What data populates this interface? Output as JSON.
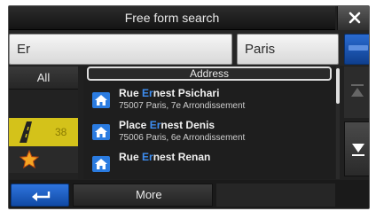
{
  "title": "Free form search",
  "search": {
    "query": "Er",
    "city": "Paris"
  },
  "tabs": {
    "all_label": "All",
    "road_count": "38"
  },
  "list": {
    "header": "Address",
    "items": [
      {
        "name_pre": "Rue ",
        "name_hl": "Er",
        "name_post": "nest Psichari",
        "address": "75007 Paris, 7e Arrondissement"
      },
      {
        "name_pre": "Place ",
        "name_hl": "Er",
        "name_post": "nest Denis",
        "address": "75006 Paris, 6e Arrondissement"
      },
      {
        "name_pre": "Rue ",
        "name_hl": "Er",
        "name_post": "nest Renan",
        "address": ""
      }
    ]
  },
  "bottom": {
    "more_label": "More"
  },
  "icons": {
    "close": "close-icon",
    "home": "house-icon",
    "road": "road-icon",
    "favorite": "star-icon",
    "up": "arrow-up-icon",
    "down": "arrow-down-icon",
    "back": "back-arrow-icon"
  },
  "colors": {
    "accent_blue": "#2a6bd0",
    "highlight_text": "#3d8df0",
    "road_tab": "#d4c21a"
  }
}
